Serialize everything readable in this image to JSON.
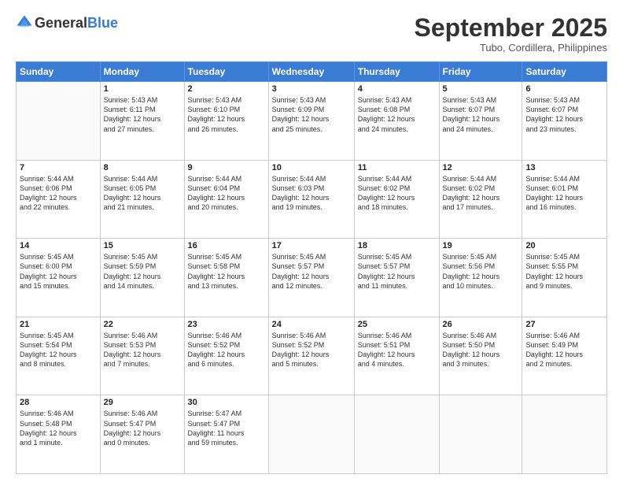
{
  "logo": {
    "general": "General",
    "blue": "Blue"
  },
  "title": {
    "month_year": "September 2025",
    "location": "Tubo, Cordillera, Philippines"
  },
  "weekdays": [
    "Sunday",
    "Monday",
    "Tuesday",
    "Wednesday",
    "Thursday",
    "Friday",
    "Saturday"
  ],
  "weeks": [
    [
      {
        "day": "",
        "info": ""
      },
      {
        "day": "1",
        "info": "Sunrise: 5:43 AM\nSunset: 6:11 PM\nDaylight: 12 hours\nand 27 minutes."
      },
      {
        "day": "2",
        "info": "Sunrise: 5:43 AM\nSunset: 6:10 PM\nDaylight: 12 hours\nand 26 minutes."
      },
      {
        "day": "3",
        "info": "Sunrise: 5:43 AM\nSunset: 6:09 PM\nDaylight: 12 hours\nand 25 minutes."
      },
      {
        "day": "4",
        "info": "Sunrise: 5:43 AM\nSunset: 6:08 PM\nDaylight: 12 hours\nand 24 minutes."
      },
      {
        "day": "5",
        "info": "Sunrise: 5:43 AM\nSunset: 6:07 PM\nDaylight: 12 hours\nand 24 minutes."
      },
      {
        "day": "6",
        "info": "Sunrise: 5:43 AM\nSunset: 6:07 PM\nDaylight: 12 hours\nand 23 minutes."
      }
    ],
    [
      {
        "day": "7",
        "info": "Sunrise: 5:44 AM\nSunset: 6:06 PM\nDaylight: 12 hours\nand 22 minutes."
      },
      {
        "day": "8",
        "info": "Sunrise: 5:44 AM\nSunset: 6:05 PM\nDaylight: 12 hours\nand 21 minutes."
      },
      {
        "day": "9",
        "info": "Sunrise: 5:44 AM\nSunset: 6:04 PM\nDaylight: 12 hours\nand 20 minutes."
      },
      {
        "day": "10",
        "info": "Sunrise: 5:44 AM\nSunset: 6:03 PM\nDaylight: 12 hours\nand 19 minutes."
      },
      {
        "day": "11",
        "info": "Sunrise: 5:44 AM\nSunset: 6:02 PM\nDaylight: 12 hours\nand 18 minutes."
      },
      {
        "day": "12",
        "info": "Sunrise: 5:44 AM\nSunset: 6:02 PM\nDaylight: 12 hours\nand 17 minutes."
      },
      {
        "day": "13",
        "info": "Sunrise: 5:44 AM\nSunset: 6:01 PM\nDaylight: 12 hours\nand 16 minutes."
      }
    ],
    [
      {
        "day": "14",
        "info": "Sunrise: 5:45 AM\nSunset: 6:00 PM\nDaylight: 12 hours\nand 15 minutes."
      },
      {
        "day": "15",
        "info": "Sunrise: 5:45 AM\nSunset: 5:59 PM\nDaylight: 12 hours\nand 14 minutes."
      },
      {
        "day": "16",
        "info": "Sunrise: 5:45 AM\nSunset: 5:58 PM\nDaylight: 12 hours\nand 13 minutes."
      },
      {
        "day": "17",
        "info": "Sunrise: 5:45 AM\nSunset: 5:57 PM\nDaylight: 12 hours\nand 12 minutes."
      },
      {
        "day": "18",
        "info": "Sunrise: 5:45 AM\nSunset: 5:57 PM\nDaylight: 12 hours\nand 11 minutes."
      },
      {
        "day": "19",
        "info": "Sunrise: 5:45 AM\nSunset: 5:56 PM\nDaylight: 12 hours\nand 10 minutes."
      },
      {
        "day": "20",
        "info": "Sunrise: 5:45 AM\nSunset: 5:55 PM\nDaylight: 12 hours\nand 9 minutes."
      }
    ],
    [
      {
        "day": "21",
        "info": "Sunrise: 5:45 AM\nSunset: 5:54 PM\nDaylight: 12 hours\nand 8 minutes."
      },
      {
        "day": "22",
        "info": "Sunrise: 5:46 AM\nSunset: 5:53 PM\nDaylight: 12 hours\nand 7 minutes."
      },
      {
        "day": "23",
        "info": "Sunrise: 5:46 AM\nSunset: 5:52 PM\nDaylight: 12 hours\nand 6 minutes."
      },
      {
        "day": "24",
        "info": "Sunrise: 5:46 AM\nSunset: 5:52 PM\nDaylight: 12 hours\nand 5 minutes."
      },
      {
        "day": "25",
        "info": "Sunrise: 5:46 AM\nSunset: 5:51 PM\nDaylight: 12 hours\nand 4 minutes."
      },
      {
        "day": "26",
        "info": "Sunrise: 5:46 AM\nSunset: 5:50 PM\nDaylight: 12 hours\nand 3 minutes."
      },
      {
        "day": "27",
        "info": "Sunrise: 5:46 AM\nSunset: 5:49 PM\nDaylight: 12 hours\nand 2 minutes."
      }
    ],
    [
      {
        "day": "28",
        "info": "Sunrise: 5:46 AM\nSunset: 5:48 PM\nDaylight: 12 hours\nand 1 minute."
      },
      {
        "day": "29",
        "info": "Sunrise: 5:46 AM\nSunset: 5:47 PM\nDaylight: 12 hours\nand 0 minutes."
      },
      {
        "day": "30",
        "info": "Sunrise: 5:47 AM\nSunset: 5:47 PM\nDaylight: 11 hours\nand 59 minutes."
      },
      {
        "day": "",
        "info": ""
      },
      {
        "day": "",
        "info": ""
      },
      {
        "day": "",
        "info": ""
      },
      {
        "day": "",
        "info": ""
      }
    ]
  ]
}
